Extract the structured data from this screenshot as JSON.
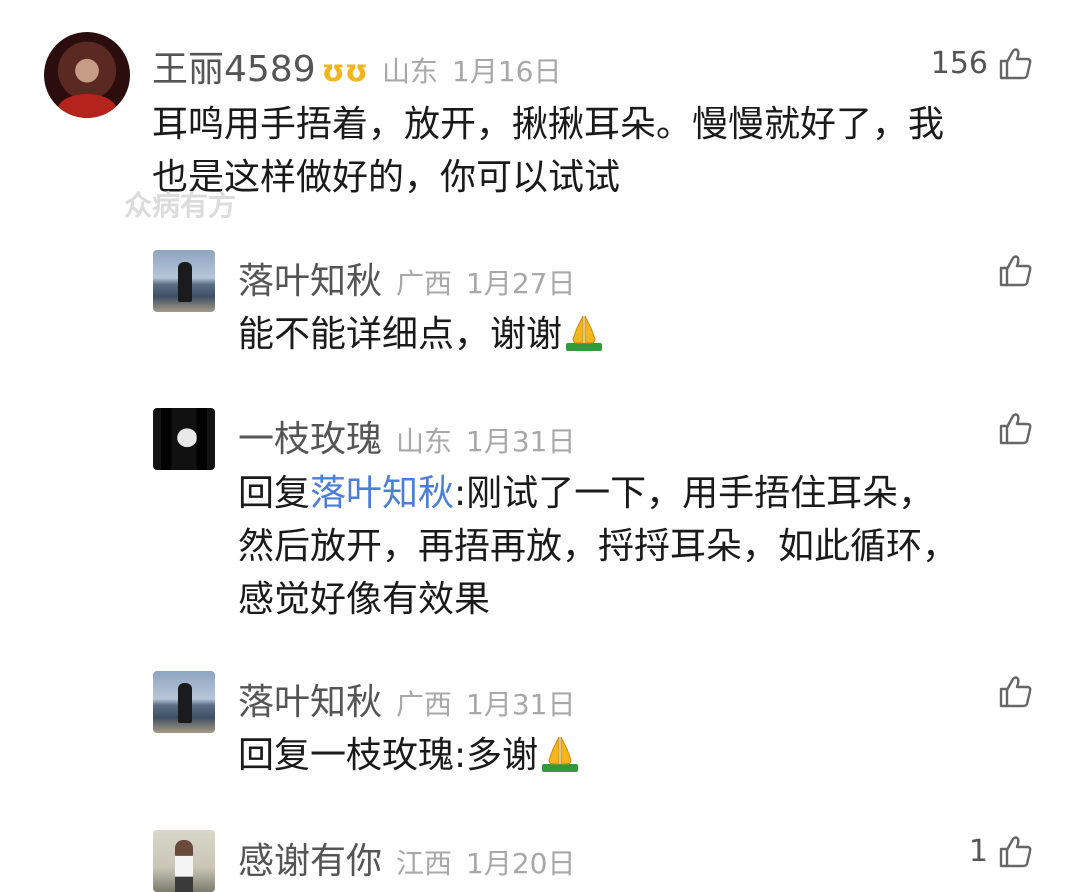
{
  "watermark": "众病有方",
  "comments": [
    {
      "name": "王丽4589",
      "badge": "ʊʊ",
      "location": "山东",
      "date": "1月16日",
      "likes": "156",
      "lines": [
        "耳鸣用手捂着，放开，揪揪耳朵。慢慢就好了，我",
        "也是这样做好的，你可以试试"
      ]
    },
    {
      "name": "落叶知秋",
      "location": "广西",
      "date": "1月27日",
      "likes": "",
      "text": "能不能详细点，谢谢",
      "emoji": "pray-emoji"
    },
    {
      "name": "一枝玫瑰",
      "location": "山东",
      "date": "1月31日",
      "likes": "",
      "reply_prefix": "回复",
      "reply_to": "落叶知秋",
      "lines": [
        ":刚试了一下，用手捂住耳朵，",
        "然后放开，再捂再放，捋捋耳朵，如此循环，",
        "感觉好像有效果"
      ]
    },
    {
      "name": "落叶知秋",
      "location": "广西",
      "date": "1月31日",
      "likes": "",
      "text": "回复一枝玫瑰:多谢",
      "emoji": "pray-emoji"
    },
    {
      "name": "感谢有你",
      "location": "江西",
      "date": "1月20日",
      "likes": "1"
    }
  ]
}
